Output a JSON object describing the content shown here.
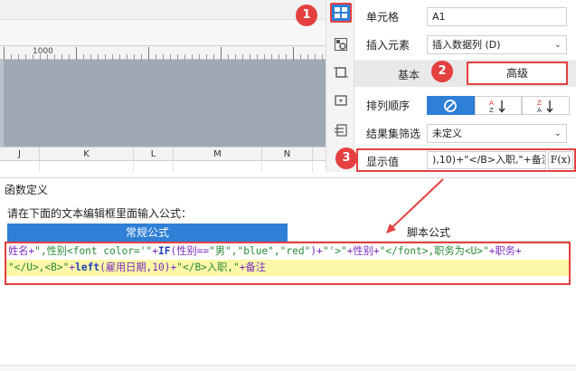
{
  "ruler": {
    "label": "1000"
  },
  "columns": [
    "J",
    "K",
    "L",
    "M",
    "N"
  ],
  "sidebar_icons": [
    {
      "name": "cell-element-icon",
      "active": true
    },
    {
      "name": "widget-settings-icon",
      "active": false
    },
    {
      "name": "border-icon",
      "active": false
    },
    {
      "name": "hyperlink-icon",
      "active": false
    },
    {
      "name": "table-layout-icon",
      "active": false
    }
  ],
  "panel": {
    "cell_label": "单元格",
    "cell_value": "A1",
    "insert_label": "插入元素",
    "insert_value": "插入数据列 (D)",
    "tab_basic": "基本",
    "tab_advanced": "高级",
    "sort_label": "排列顺序",
    "filter_label": "结果集筛选",
    "filter_value": "未定义",
    "display_label": "显示值",
    "display_value": "),10)+\"</B>入职,\"+备注",
    "fx_label": "F(x)"
  },
  "badges": [
    "1",
    "2",
    "3"
  ],
  "dialog": {
    "title": "函数定义",
    "prompt": "请在下面的文本编辑框里面输入公式：",
    "tab_regular": "常规公式",
    "tab_script": "脚本公式"
  },
  "formula": {
    "line1": [
      {
        "t": "姓名+",
        "c": "k"
      },
      {
        "t": "\",性别<font color='\"",
        "c": "s"
      },
      {
        "t": "+",
        "c": "k"
      },
      {
        "t": "IF",
        "c": "b"
      },
      {
        "t": "(性别==",
        "c": "k"
      },
      {
        "t": "\"男\",\"blue\",\"red\"",
        "c": "s"
      },
      {
        "t": ")+",
        "c": "k"
      },
      {
        "t": "\"'>\"",
        "c": "s"
      },
      {
        "t": "+性别+",
        "c": "k"
      },
      {
        "t": "\"</font>,职务为<U>\"",
        "c": "s"
      },
      {
        "t": "+职务+",
        "c": "k"
      }
    ],
    "line2": [
      {
        "t": "\"</U>,<B>\"",
        "c": "s"
      },
      {
        "t": "+",
        "c": "k"
      },
      {
        "t": "left",
        "c": "b"
      },
      {
        "t": "(雇用日期,10)+",
        "c": "k"
      },
      {
        "t": "\"</B>入职,\"",
        "c": "s"
      },
      {
        "t": "+备注",
        "c": "k"
      }
    ]
  },
  "colors": {
    "accent": "#2e7fd6",
    "highlight": "#e54040",
    "line_highlight": "#fbf8a8"
  }
}
